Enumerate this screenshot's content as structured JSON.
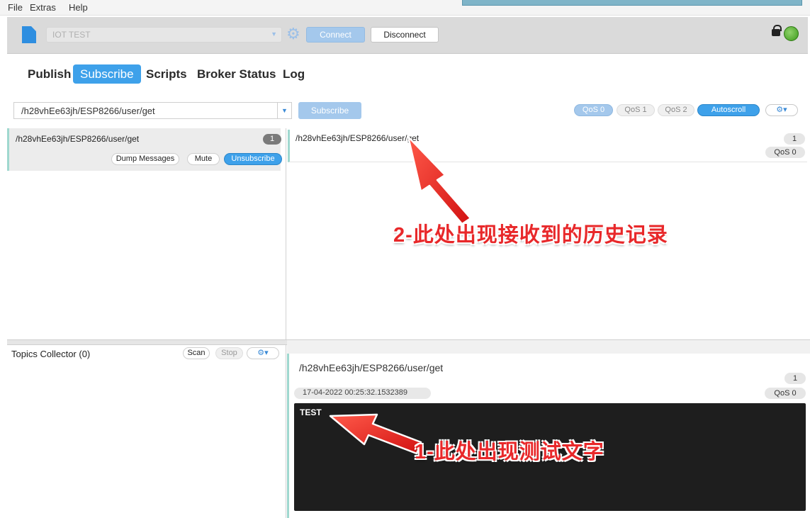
{
  "menu": {
    "file": "File",
    "extras": "Extras",
    "help": "Help"
  },
  "toolbar": {
    "profile": "IOT TEST",
    "connect_label": "Connect",
    "disconnect_label": "Disconnect",
    "status_color": "#3c9a1c"
  },
  "tabs": [
    {
      "label": "Publish"
    },
    {
      "label": "Subscribe",
      "active": true
    },
    {
      "label": "Scripts"
    },
    {
      "label": "Broker Status"
    },
    {
      "label": "Log"
    }
  ],
  "subscribe_bar": {
    "topic_value": "/h28vhEe63jh/ESP8266/user/get",
    "subscribe_label": "Subscribe",
    "qos": [
      "QoS 0",
      "QoS 1",
      "QoS 2"
    ],
    "autoscroll_label": "Autoscroll",
    "options_icon": "gear-icon"
  },
  "subscriptions": [
    {
      "topic": "/h28vhEe63jh/ESP8266/user/get",
      "count": "1",
      "dump_label": "Dump Messages",
      "mute_label": "Mute",
      "unsubscribe_label": "Unsubscribe"
    }
  ],
  "topics_collector": {
    "title": "Topics Collector (0)",
    "scan_label": "Scan",
    "stop_label": "Stop"
  },
  "messages": [
    {
      "topic": "/h28vhEe63jh/ESP8266/user/get",
      "count": "1",
      "qos": "QoS 0"
    }
  ],
  "detail": {
    "topic": "/h28vhEe63jh/ESP8266/user/get",
    "count": "1",
    "timestamp": "17-04-2022  00:25:32.1532389",
    "qos": "QoS 0",
    "payload": "TEST"
  },
  "annotations": {
    "history": "2-此处出现接收到的历史记录",
    "test_text": "1-此处出现测试文字",
    "color": "#e8282a"
  }
}
